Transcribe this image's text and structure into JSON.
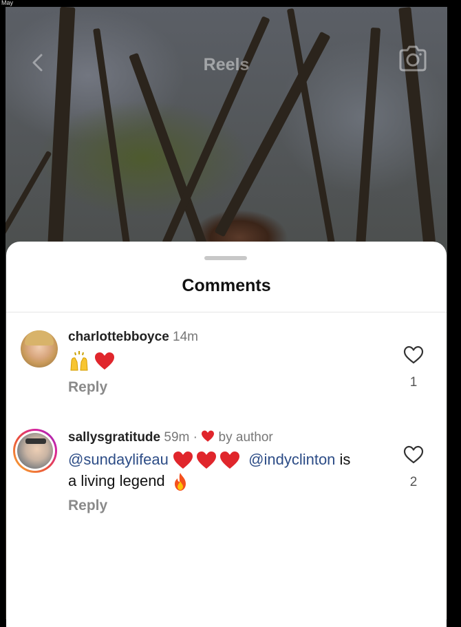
{
  "status_bar": {
    "text": "May"
  },
  "header": {
    "title": "Reels"
  },
  "sheet": {
    "title": "Comments"
  },
  "comments": [
    {
      "username": "charlottebboyce",
      "time": "14m",
      "text_emojis": "raised-hands, red-heart",
      "reply_label": "Reply",
      "likes": "1"
    },
    {
      "username": "sallysgratitude",
      "time": "59m",
      "separator": "·",
      "author_badge": "by author",
      "mention1": "@sundaylifeau",
      "mention2": "@indyclinton",
      "text_after_mention": " is",
      "text_line2": "a living legend",
      "reply_label": "Reply",
      "likes": "2"
    }
  ],
  "colors": {
    "mention": "#2c4c86",
    "heart": "#e0262c",
    "story_ring": "#d6249f"
  }
}
